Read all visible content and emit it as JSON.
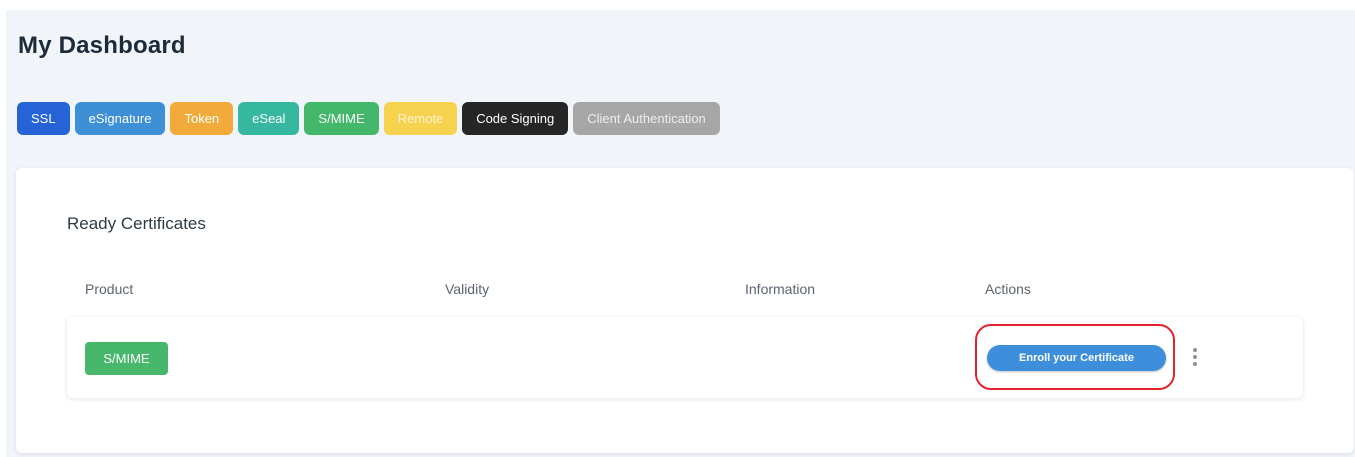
{
  "page_title": "My Dashboard",
  "tabs": [
    {
      "label": "SSL",
      "color": "#2563d6"
    },
    {
      "label": "eSignature",
      "color": "#3d8fd6"
    },
    {
      "label": "Token",
      "color": "#f2ab3b"
    },
    {
      "label": "eSeal",
      "color": "#36b8a0"
    },
    {
      "label": "S/MIME",
      "color": "#44b86a"
    },
    {
      "label": "Remote",
      "color": "#f7d24f"
    },
    {
      "label": "Code Signing",
      "color": "#262626"
    },
    {
      "label": "Client Authentication",
      "color": "#a6a6a6"
    }
  ],
  "card": {
    "title": "Ready Certificates",
    "columns": {
      "product": "Product",
      "validity": "Validity",
      "information": "Information",
      "actions": "Actions"
    },
    "rows": [
      {
        "product": "S/MIME",
        "validity": "",
        "information": "",
        "action_label": "Enroll your Certificate",
        "more_icon": "kebab-menu-icon"
      }
    ]
  },
  "highlight_color": "#e2232c"
}
